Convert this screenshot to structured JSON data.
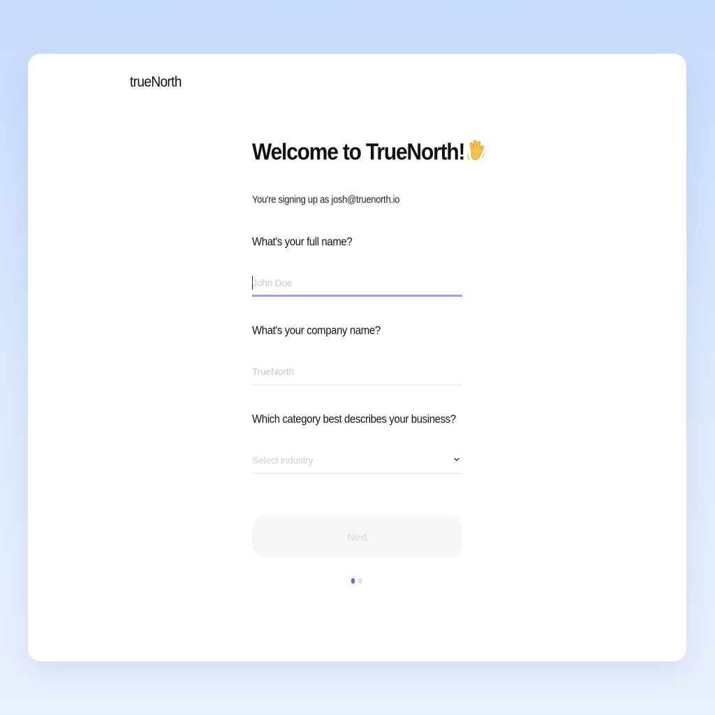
{
  "brand": {
    "logo_text": "trueNorth"
  },
  "onboarding": {
    "title": "Welcome to TrueNorth!",
    "title_emoji_icon": "waving-hand-icon",
    "subtitle": "You're signing up as josh@truenorth.io",
    "full_name": {
      "label": "What's your full name?",
      "placeholder": "John Doe",
      "value": ""
    },
    "company_name": {
      "label": "What's your company name?",
      "placeholder": "TrueNorth",
      "value": ""
    },
    "industry": {
      "label": "Which category best describes your business?",
      "selected_text": "Select industry",
      "icon": "chevron-down-icon"
    },
    "next_button_label": "Next",
    "pagination": {
      "current_step": 1,
      "total_steps": 2
    }
  },
  "colors": {
    "accent": "#6f63e6",
    "active_underline": "#a99cf0",
    "background_top": "#c6dbfd",
    "background_bottom": "#eaf1fd"
  }
}
